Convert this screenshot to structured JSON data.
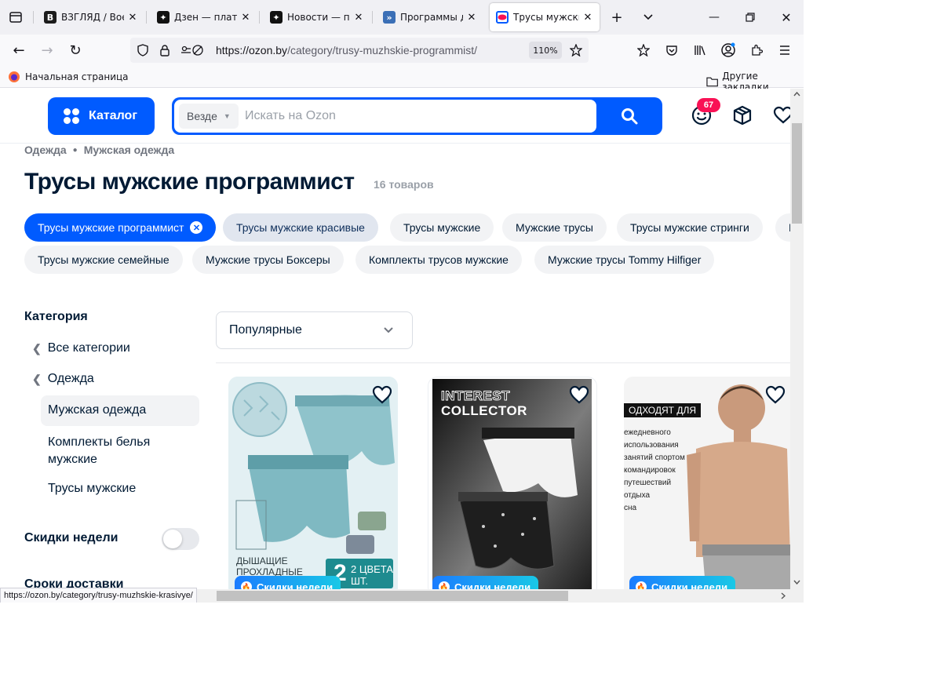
{
  "browser": {
    "tabs": [
      {
        "title": "ВЗГЛЯД / Военн",
        "icon": "vzglyad-favicon"
      },
      {
        "title": "Дзен — платфор",
        "icon": "dzen-favicon"
      },
      {
        "title": "Новости — посл",
        "icon": "dzen-favicon"
      },
      {
        "title": "Программы для",
        "icon": "programs-favicon"
      },
      {
        "title": "Трусы мужские",
        "icon": "ozon-favicon"
      }
    ],
    "url_host": "https://ozon.by",
    "url_path": "/category/trusy-muzhskie-programmist/",
    "zoom": "110%",
    "bookmarks": {
      "home": "Начальная страница",
      "other": "Другие закладки"
    },
    "status_url": "https://ozon.by/category/trusy-muzhskie-krasivye/"
  },
  "header": {
    "catalog": "Каталог",
    "scope": "Везде",
    "search_placeholder": "Искать на Ozon",
    "notifications": "67",
    "accent": "#005bff"
  },
  "breadcrumbs": [
    "Одежда",
    "Мужская одежда"
  ],
  "page_title": "Трусы мужские программист",
  "item_count": "16 товаров",
  "chips": [
    "Трусы мужские программист",
    "Трусы мужские красивые",
    "Трусы мужские",
    "Мужские трусы",
    "Трусы мужские стринги",
    "Р",
    "Трусы мужские семейные",
    "Мужские трусы Боксеры",
    "Комплекты трусов мужские",
    "Мужские трусы Tommy Hilfiger"
  ],
  "sidebar": {
    "category_title": "Категория",
    "items": [
      "Все категории",
      "Одежда",
      "Мужская одежда",
      "Комплекты белья мужские",
      "Трусы мужские"
    ],
    "discounts": "Скидки недели",
    "delivery": "Сроки доставки"
  },
  "sort": {
    "selected": "Популярные"
  },
  "products": [
    {
      "image_text": [
        "ДЫШАЩИЕ",
        "ПРОХЛАДНЫЕ"
      ],
      "badge": [
        "2 ЦВЕТА",
        "ШТ."
      ],
      "promo": "Скидки недели"
    },
    {
      "image_text": [
        "INTEREST",
        "COLLECTOR"
      ],
      "promo": "Скидки недели"
    },
    {
      "image_text": [
        "ОДХОДЯТ ДЛЯ",
        "ежедневного",
        "использования",
        "занятий спортом",
        "командировок",
        "путешествий",
        "отдыха",
        "сна"
      ],
      "promo": "Скидки недели"
    }
  ]
}
